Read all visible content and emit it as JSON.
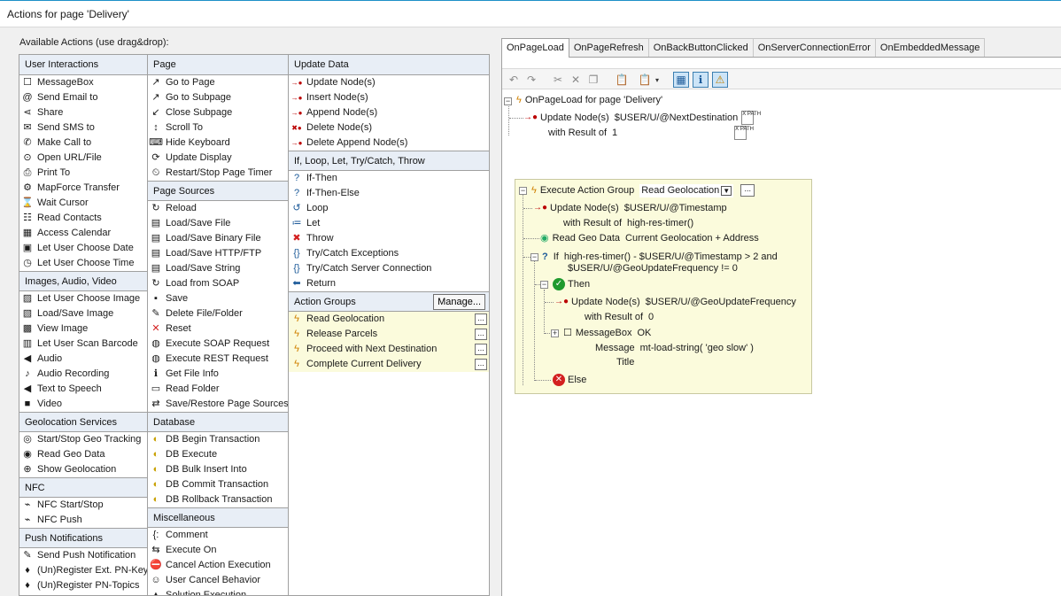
{
  "window": {
    "title": "Actions for page 'Delivery'"
  },
  "available_label": "Available Actions (use drag&drop):",
  "columns": {
    "c1": [
      {
        "heading": "User Interactions",
        "items": [
          {
            "label": "MessageBox",
            "icon": "messagebox-icon",
            "glyph": "☐"
          },
          {
            "label": "Send Email to",
            "icon": "at-sign-icon",
            "glyph": "@"
          },
          {
            "label": "Share",
            "icon": "share-icon",
            "glyph": "⋖"
          },
          {
            "label": "Send SMS to",
            "icon": "envelope-icon",
            "glyph": "✉"
          },
          {
            "label": "Make Call to",
            "icon": "phone-icon",
            "glyph": "✆"
          },
          {
            "label": "Open URL/File",
            "icon": "open-url-icon",
            "glyph": "⊙"
          },
          {
            "label": "Print To",
            "icon": "printer-icon",
            "glyph": "⎙"
          },
          {
            "label": "MapForce Transfer",
            "icon": "mapforce-icon",
            "glyph": "⚙"
          },
          {
            "label": "Wait Cursor",
            "icon": "hourglass-icon",
            "glyph": "⌛"
          },
          {
            "label": "Read Contacts",
            "icon": "contacts-icon",
            "glyph": "☷"
          },
          {
            "label": "Access Calendar",
            "icon": "calendar-icon",
            "glyph": "▦"
          },
          {
            "label": "Let User Choose Date",
            "icon": "date-icon",
            "glyph": "▣"
          },
          {
            "label": "Let User Choose Time",
            "icon": "clock-icon",
            "glyph": "◷"
          }
        ]
      },
      {
        "heading": "Images, Audio, Video",
        "items": [
          {
            "label": "Let User Choose Image",
            "icon": "image-choose-icon",
            "glyph": "▨"
          },
          {
            "label": "Load/Save Image",
            "icon": "image-save-icon",
            "glyph": "▧"
          },
          {
            "label": "View Image",
            "icon": "image-view-icon",
            "glyph": "▩"
          },
          {
            "label": "Let User Scan Barcode",
            "icon": "barcode-icon",
            "glyph": "▥"
          },
          {
            "label": "Audio",
            "icon": "speaker-icon",
            "glyph": "◀"
          },
          {
            "label": "Audio Recording",
            "icon": "microphone-icon",
            "glyph": "♪"
          },
          {
            "label": "Text to Speech",
            "icon": "speech-icon",
            "glyph": "◀"
          },
          {
            "label": "Video",
            "icon": "video-camera-icon",
            "glyph": "■"
          }
        ]
      },
      {
        "heading": "Geolocation Services",
        "items": [
          {
            "label": "Start/Stop Geo Tracking",
            "icon": "geo-tracking-icon",
            "glyph": "◎"
          },
          {
            "label": "Read Geo Data",
            "icon": "geo-data-icon",
            "glyph": "◉"
          },
          {
            "label": "Show Geolocation",
            "icon": "geolocation-icon",
            "glyph": "⊕"
          }
        ]
      },
      {
        "heading": "NFC",
        "items": [
          {
            "label": "NFC Start/Stop",
            "icon": "nfc-icon",
            "glyph": "⌁"
          },
          {
            "label": "NFC Push",
            "icon": "nfc-push-icon",
            "glyph": "⌁"
          }
        ]
      },
      {
        "heading": "Push Notifications",
        "items": [
          {
            "label": "Send Push Notification",
            "icon": "push-send-icon",
            "glyph": "✎"
          },
          {
            "label": "(Un)Register Ext. PN-Key",
            "icon": "pn-key-icon",
            "glyph": "♦"
          },
          {
            "label": "(Un)Register PN-Topics",
            "icon": "pn-topics-icon",
            "glyph": "♦"
          }
        ]
      }
    ],
    "c2": [
      {
        "heading": "Page",
        "items": [
          {
            "label": "Go to Page",
            "icon": "goto-page-icon",
            "glyph": "↗"
          },
          {
            "label": "Go to Subpage",
            "icon": "goto-subpage-icon",
            "glyph": "↗"
          },
          {
            "label": "Close Subpage",
            "icon": "close-subpage-icon",
            "glyph": "↙"
          },
          {
            "label": "Scroll To",
            "icon": "scroll-icon",
            "glyph": "↕"
          },
          {
            "label": "Hide Keyboard",
            "icon": "keyboard-icon",
            "glyph": "⌨"
          },
          {
            "label": "Update Display",
            "icon": "update-display-icon",
            "glyph": "⟳"
          },
          {
            "label": "Restart/Stop Page Timer",
            "icon": "timer-icon",
            "glyph": "⏲"
          }
        ]
      },
      {
        "heading": "Page Sources",
        "items": [
          {
            "label": "Reload",
            "icon": "reload-icon",
            "glyph": "↻"
          },
          {
            "label": "Load/Save File",
            "icon": "file-icon",
            "glyph": "▤"
          },
          {
            "label": "Load/Save Binary File",
            "icon": "binary-file-icon",
            "glyph": "▤"
          },
          {
            "label": "Load/Save HTTP/FTP",
            "icon": "http-icon",
            "glyph": "▤"
          },
          {
            "label": "Load/Save String",
            "icon": "string-icon",
            "glyph": "▤"
          },
          {
            "label": "Load from SOAP",
            "icon": "soap-icon",
            "glyph": "↻"
          },
          {
            "label": "Save",
            "icon": "save-icon",
            "glyph": "▪"
          },
          {
            "label": "Delete File/Folder",
            "icon": "delete-file-icon",
            "glyph": "✎"
          },
          {
            "label": "Reset",
            "icon": "reset-icon",
            "glyph": "✕"
          },
          {
            "label": "Execute SOAP Request",
            "icon": "globe-soap-icon",
            "glyph": "◍"
          },
          {
            "label": "Execute REST Request",
            "icon": "globe-rest-icon",
            "glyph": "◍"
          },
          {
            "label": "Get File Info",
            "icon": "file-info-icon",
            "glyph": "ℹ"
          },
          {
            "label": "Read Folder",
            "icon": "folder-icon",
            "glyph": "▭"
          },
          {
            "label": "Save/Restore Page Sources",
            "icon": "save-restore-icon",
            "glyph": "⇄"
          }
        ]
      },
      {
        "heading": "Database",
        "items": [
          {
            "label": "DB Begin Transaction",
            "icon": "db-begin-icon",
            "glyph": "◐"
          },
          {
            "label": "DB Execute",
            "icon": "db-execute-icon",
            "glyph": "◐"
          },
          {
            "label": "DB Bulk Insert Into",
            "icon": "db-bulk-icon",
            "glyph": "◐"
          },
          {
            "label": "DB Commit Transaction",
            "icon": "db-commit-icon",
            "glyph": "◐"
          },
          {
            "label": "DB Rollback Transaction",
            "icon": "db-rollback-icon",
            "glyph": "◐"
          }
        ]
      },
      {
        "heading": "Miscellaneous",
        "items": [
          {
            "label": "Comment",
            "icon": "comment-icon",
            "glyph": "{:"
          },
          {
            "label": "Execute On",
            "icon": "execute-on-icon",
            "glyph": "⇆"
          },
          {
            "label": "Cancel Action Execution",
            "icon": "cancel-action-icon",
            "glyph": "⛔"
          },
          {
            "label": "User Cancel Behavior",
            "icon": "user-cancel-icon",
            "glyph": "☺"
          },
          {
            "label": "Solution Execution",
            "icon": "solution-icon",
            "glyph": "▲"
          }
        ]
      }
    ],
    "c3": [
      {
        "heading": "Update Data",
        "items": [
          {
            "label": "Update Node(s)",
            "icon": "update-node-icon",
            "glyph": "→●"
          },
          {
            "label": "Insert Node(s)",
            "icon": "insert-node-icon",
            "glyph": "→●"
          },
          {
            "label": "Append Node(s)",
            "icon": "append-node-icon",
            "glyph": "→●"
          },
          {
            "label": "Delete Node(s)",
            "icon": "delete-node-icon",
            "glyph": "✖●"
          },
          {
            "label": "Delete Append Node(s)",
            "icon": "delete-append-icon",
            "glyph": "→●"
          }
        ]
      },
      {
        "heading": "If, Loop, Let, Try/Catch, Throw",
        "items": [
          {
            "label": "If-Then",
            "icon": "question-icon",
            "glyph": "?"
          },
          {
            "label": "If-Then-Else",
            "icon": "question-icon",
            "glyph": "?"
          },
          {
            "label": "Loop",
            "icon": "loop-icon",
            "glyph": "↺"
          },
          {
            "label": "Let",
            "icon": "let-icon",
            "glyph": "≔"
          },
          {
            "label": "Throw",
            "icon": "throw-icon",
            "glyph": "✖"
          },
          {
            "label": "Try/Catch Exceptions",
            "icon": "try-catch-icon",
            "glyph": "{}"
          },
          {
            "label": "Try/Catch Server Connection",
            "icon": "try-catch-server-icon",
            "glyph": "{}"
          },
          {
            "label": "Return",
            "icon": "return-icon",
            "glyph": "⬅"
          }
        ]
      },
      {
        "heading": "Action Groups",
        "manage": "Manage...",
        "items": [
          {
            "label": "Read Geolocation",
            "icon": "action-group-icon",
            "glyph": "ϟ",
            "dots": "..."
          },
          {
            "label": "Release Parcels",
            "icon": "action-group-icon",
            "glyph": "ϟ",
            "dots": "..."
          },
          {
            "label": "Proceed with Next Destination",
            "icon": "action-group-icon",
            "glyph": "ϟ",
            "dots": "..."
          },
          {
            "label": "Complete Current Delivery",
            "icon": "action-group-icon",
            "glyph": "ϟ",
            "dots": "..."
          }
        ]
      }
    ]
  },
  "tabs": [
    "OnPageLoad",
    "OnPageRefresh",
    "OnBackButtonClicked",
    "OnServerConnectionError",
    "OnEmbeddedMessage"
  ],
  "tree": {
    "root": "OnPageLoad for page 'Delivery'",
    "update1_label": "Update Node(s)",
    "update1_value": "$USER/U/@NextDestination",
    "update1_with": "with Result of",
    "update1_result": "1",
    "xpath_text": "X PATH",
    "group_label": "Execute Action Group",
    "group_value": "Read Geolocation",
    "group_dots": "...",
    "update2_label": "Update Node(s)",
    "update2_value": "$USER/U/@Timestamp",
    "update2_with": "with Result of",
    "update2_result": "high-res-timer()",
    "geo_label": "Read Geo Data",
    "geo_value": "Current Geolocation + Address",
    "if_label": "If",
    "if_line1": "high-res-timer() - $USER/U/@Timestamp > 2 and",
    "if_line2": "$USER/U/@GeoUpdateFrequency != 0",
    "then_label": "Then",
    "update3_label": "Update Node(s)",
    "update3_value": "$USER/U/@GeoUpdateFrequency",
    "update3_with": "with Result of",
    "update3_result": "0",
    "mb_label": "MessageBox",
    "mb_value": "OK",
    "mb_msg_label": "Message",
    "mb_msg_value": "mt-load-string( 'geo slow' )",
    "mb_title_label": "Title",
    "else_label": "Else"
  },
  "colors": {
    "accent": "#1e90c8",
    "group_bg": "#fbfbdc",
    "header_bg": "#e8eef6",
    "ok": "#1f9a2e",
    "error": "#d32020"
  }
}
